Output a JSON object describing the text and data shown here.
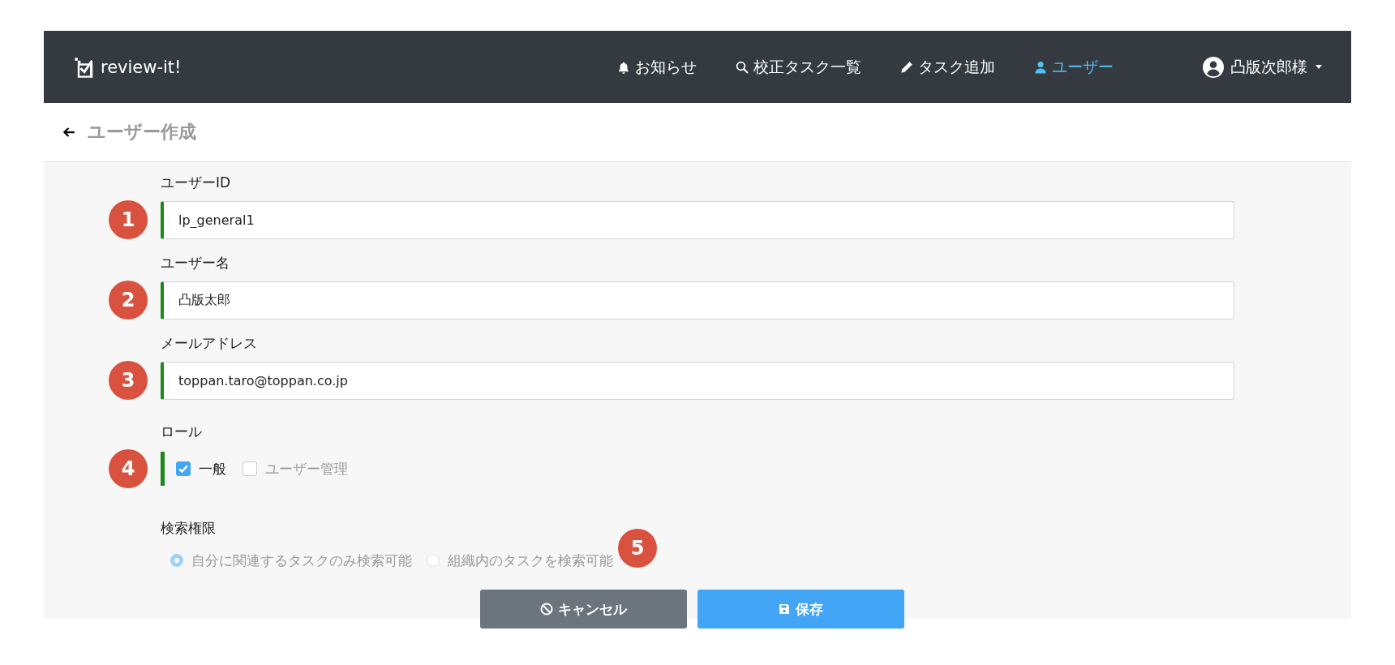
{
  "navbar": {
    "brand": "review-it!",
    "items": [
      {
        "kind": "bell",
        "label": "お知らせ",
        "selected": false
      },
      {
        "kind": "search",
        "label": "校正タスク一覧",
        "selected": false
      },
      {
        "kind": "pencil",
        "label": "タスク追加",
        "selected": false
      },
      {
        "kind": "user",
        "label": "ユーザー",
        "selected": true
      }
    ],
    "account": {
      "label": "凸版次郎様"
    }
  },
  "page_title": "ユーザー作成",
  "fields": [
    {
      "label": "ユーザーID",
      "value": "lp_general1",
      "badge": "1",
      "valid": true
    },
    {
      "label": "ユーザー名",
      "value": "凸版太郎",
      "badge": "2",
      "valid": true
    },
    {
      "label": "メールアドレス",
      "value": "toppan.taro@toppan.co.jp",
      "badge": "3",
      "valid": true
    }
  ],
  "role": {
    "label": "ロール",
    "badge": "4",
    "valid": true,
    "options": [
      {
        "label": "一般",
        "checked": true,
        "disabled": false
      },
      {
        "label": "ユーザー管理",
        "checked": false,
        "disabled": true
      }
    ]
  },
  "search_scope": {
    "label": "検索権限",
    "badge": "5",
    "disabled": true,
    "options": [
      {
        "label": "自分に関連するタスクのみ検索可能",
        "selected": true
      },
      {
        "label": "組織内のタスクを検索可能",
        "selected": false
      }
    ]
  },
  "buttons": [
    {
      "kind": "cancel",
      "label": "キャンセル"
    },
    {
      "kind": "save",
      "label": "保存"
    }
  ]
}
